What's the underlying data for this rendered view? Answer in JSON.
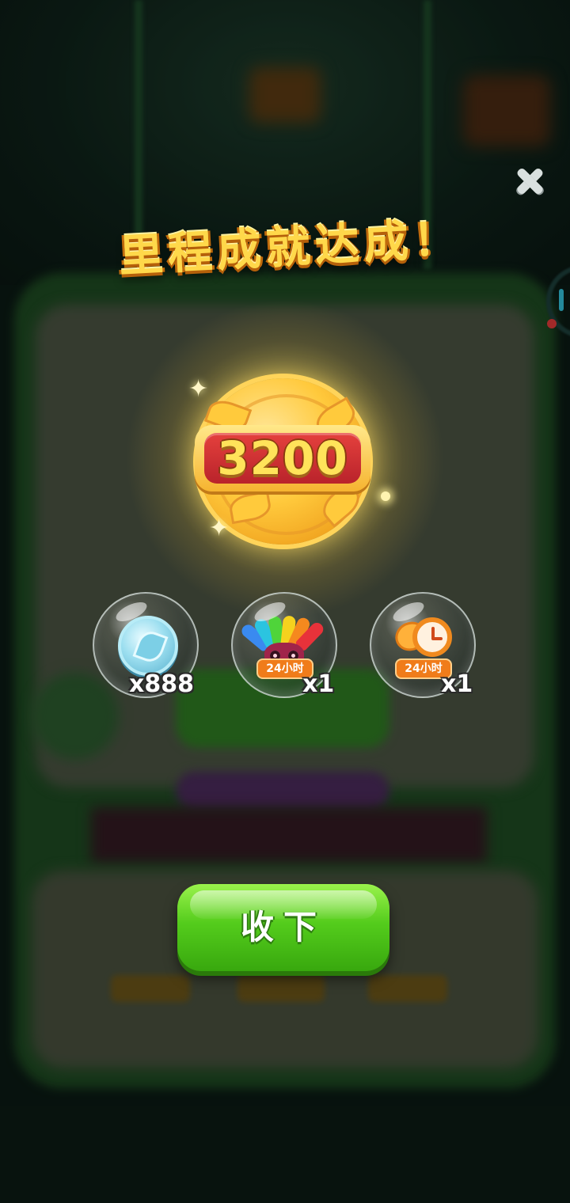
{
  "title": "里程成就达成！",
  "medal": {
    "value": "3200"
  },
  "rewards": [
    {
      "icon": "leaf-coin-icon",
      "tag": "",
      "quantity": "x888"
    },
    {
      "icon": "rainbow-bird-icon",
      "tag": "24小时",
      "quantity": "x1"
    },
    {
      "icon": "clock-icon",
      "tag": "24小时",
      "quantity": "x1"
    }
  ],
  "buttons": {
    "collect": "收下",
    "close_icon": "close-icon"
  },
  "colors": {
    "title": "#ffd84a",
    "button": "#54cc1c",
    "medal": "#ffc93c",
    "plate": "#d1303a",
    "tag": "#f07c1a"
  }
}
